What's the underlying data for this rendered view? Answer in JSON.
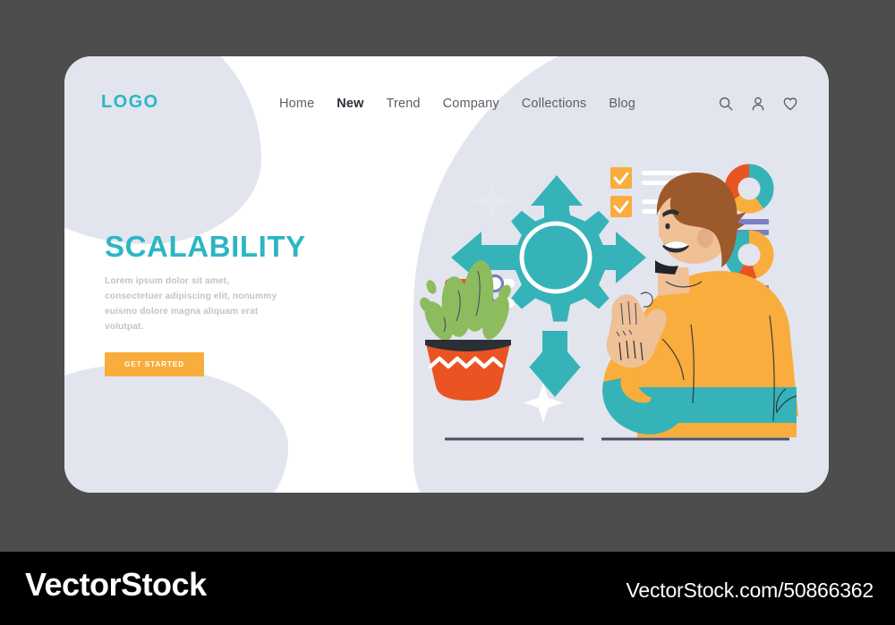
{
  "page": {
    "background_color": "#4d4d4d",
    "card_background": "#ffffff",
    "blob_color": "#e2e5ee"
  },
  "header": {
    "logo": "LOGO",
    "logo_color": "#2cb6c4",
    "nav": [
      {
        "label": "Home",
        "active": false
      },
      {
        "label": "New",
        "active": true
      },
      {
        "label": "Trend",
        "active": false
      },
      {
        "label": "Company",
        "active": false
      },
      {
        "label": "Collections",
        "active": false
      },
      {
        "label": "Blog",
        "active": false
      }
    ],
    "icons": [
      {
        "name": "search-icon"
      },
      {
        "name": "user-icon"
      },
      {
        "name": "heart-icon"
      }
    ]
  },
  "hero": {
    "title": "SCALABILITY",
    "title_color": "#2cb6c4",
    "description": "Lorem ipsum dolor sit amet, consectetuer adipiscing elit, nonummy euismo dolore magna aliquam erat volutpat.",
    "cta_label": "GET STARTED",
    "cta_color": "#f9ad3c"
  },
  "illustration": {
    "name": "scalability-scene",
    "teal": "#35b3b8",
    "orange": "#f9ad3c",
    "red_orange": "#ea5322",
    "purple": "#7b7fc4",
    "skin": "#f0c096",
    "hair": "#9c5a2c",
    "ground_line": "#4a4f63",
    "checkboxes": [
      {
        "checked": true
      },
      {
        "checked": true
      }
    ],
    "sliders": [
      {
        "fill_percent": 66
      },
      {
        "fill_percent": 54
      }
    ],
    "donut_charts": [
      {
        "name": "donut-chart-top",
        "segments": [
          {
            "color": "#35b3b8",
            "percent": 40
          },
          {
            "color": "#f9ad3c",
            "percent": 25
          },
          {
            "color": "#ea5322",
            "percent": 35
          }
        ]
      },
      {
        "name": "donut-chart-bottom",
        "segments": [
          {
            "color": "#f9ad3c",
            "percent": 45
          },
          {
            "color": "#ea5322",
            "percent": 13
          },
          {
            "color": "#35b3b8",
            "percent": 42
          }
        ]
      }
    ],
    "arrows": [
      "up",
      "right",
      "down",
      "left"
    ],
    "plant": {
      "pot_color": "#ea5322",
      "leaf_color": "#8cbc5e"
    }
  },
  "watermark": {
    "brand": "VectorStock",
    "url": "VectorStock.com/50866362"
  }
}
